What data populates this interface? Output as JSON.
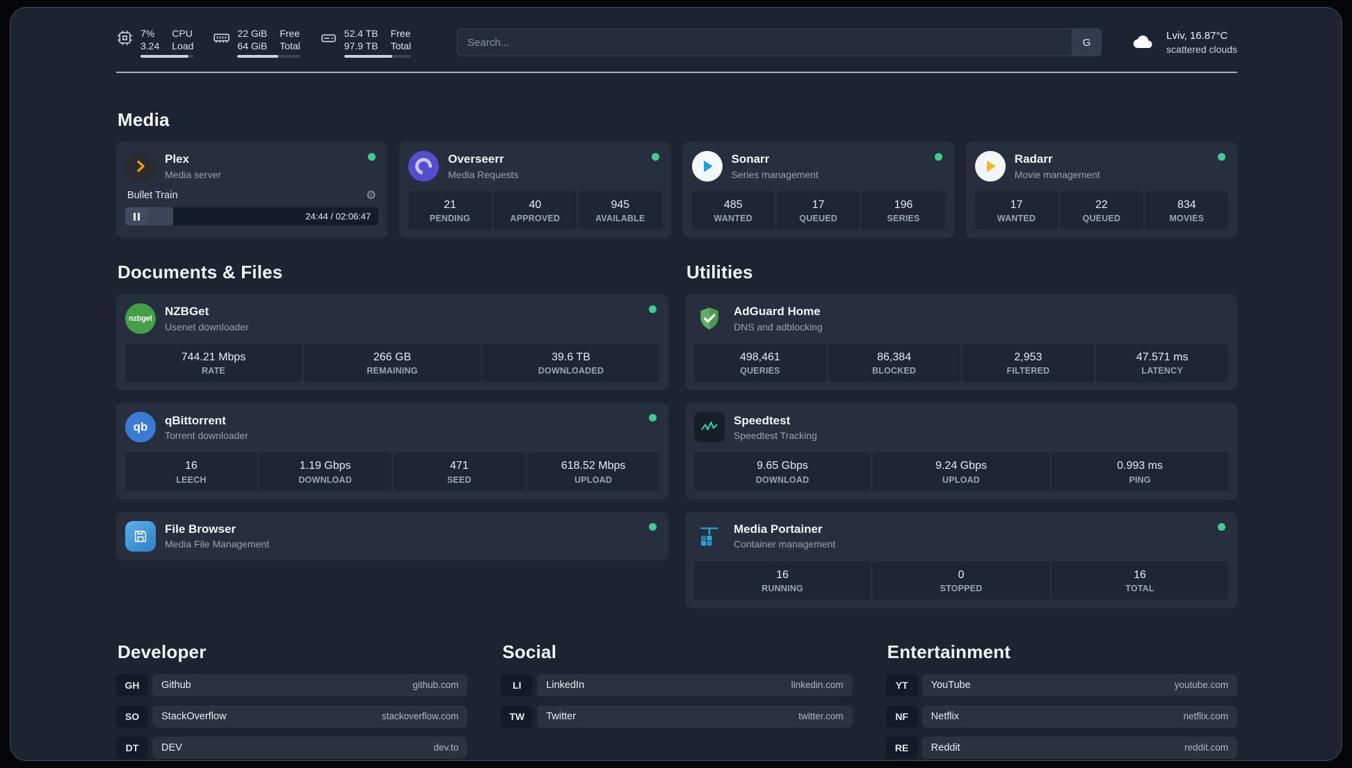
{
  "colors": {
    "background": "#1c2432",
    "card": "#272f3e",
    "stat_tile": "#1e2634",
    "status_green": "#3ecf8e",
    "plex_amber": "#e5a00d"
  },
  "topbar": {
    "cpu": {
      "value_top": "7%",
      "value_bottom": "3.24",
      "label_top": "CPU",
      "label_bottom": "Load",
      "bar_percent": 90
    },
    "ram": {
      "value_top": "22 GiB",
      "value_bottom": "64 GiB",
      "label_top": "Free",
      "label_bottom": "Total",
      "bar_percent": 65
    },
    "disk": {
      "value_top": "52.4 TB",
      "value_bottom": "97.9 TB",
      "label_top": "Free",
      "label_bottom": "Total",
      "bar_percent": 72
    },
    "search": {
      "placeholder": "Search...",
      "button_label": "G"
    },
    "weather": {
      "location": "Lviv, 16.87°C",
      "condition": "scattered clouds"
    }
  },
  "sections": {
    "media": "Media",
    "documents": "Documents & Files",
    "utilities": "Utilities"
  },
  "services": {
    "plex": {
      "name": "Plex",
      "subtitle": "Media server",
      "now_playing": "Bullet Train",
      "time": "24:44 / 02:06:47",
      "progress_percent": 19
    },
    "overseerr": {
      "name": "Overseerr",
      "subtitle": "Media Requests",
      "stats": [
        {
          "value": "21",
          "label": "PENDING"
        },
        {
          "value": "40",
          "label": "APPROVED"
        },
        {
          "value": "945",
          "label": "AVAILABLE"
        }
      ]
    },
    "sonarr": {
      "name": "Sonarr",
      "subtitle": "Series management",
      "stats": [
        {
          "value": "485",
          "label": "WANTED"
        },
        {
          "value": "17",
          "label": "QUEUED"
        },
        {
          "value": "196",
          "label": "SERIES"
        }
      ]
    },
    "radarr": {
      "name": "Radarr",
      "subtitle": "Movie management",
      "stats": [
        {
          "value": "17",
          "label": "WANTED"
        },
        {
          "value": "22",
          "label": "QUEUED"
        },
        {
          "value": "834",
          "label": "MOVIES"
        }
      ]
    },
    "nzbget": {
      "name": "NZBGet",
      "subtitle": "Usenet downloader",
      "icon_text": "nzbget",
      "stats": [
        {
          "value": "744.21 Mbps",
          "label": "RATE"
        },
        {
          "value": "266 GB",
          "label": "REMAINING"
        },
        {
          "value": "39.6 TB",
          "label": "DOWNLOADED"
        }
      ]
    },
    "qbittorrent": {
      "name": "qBittorrent",
      "subtitle": "Torrent downloader",
      "icon_text": "qb",
      "stats": [
        {
          "value": "16",
          "label": "LEECH"
        },
        {
          "value": "1.19 Gbps",
          "label": "DOWNLOAD"
        },
        {
          "value": "471",
          "label": "SEED"
        },
        {
          "value": "618.52 Mbps",
          "label": "UPLOAD"
        }
      ]
    },
    "filebrowser": {
      "name": "File Browser",
      "subtitle": "Media File Management"
    },
    "adguard": {
      "name": "AdGuard Home",
      "subtitle": "DNS and adblocking",
      "stats": [
        {
          "value": "498,461",
          "label": "QUERIES"
        },
        {
          "value": "86,384",
          "label": "BLOCKED"
        },
        {
          "value": "2,953",
          "label": "FILTERED"
        },
        {
          "value": "47.571 ms",
          "label": "LATENCY"
        }
      ]
    },
    "speedtest": {
      "name": "Speedtest",
      "subtitle": "Speedtest Tracking",
      "stats": [
        {
          "value": "9.65 Gbps",
          "label": "DOWNLOAD"
        },
        {
          "value": "9.24 Gbps",
          "label": "UPLOAD"
        },
        {
          "value": "0.993 ms",
          "label": "PING"
        }
      ]
    },
    "portainer": {
      "name": "Media Portainer",
      "subtitle": "Container management",
      "stats": [
        {
          "value": "16",
          "label": "RUNNING"
        },
        {
          "value": "0",
          "label": "STOPPED"
        },
        {
          "value": "16",
          "label": "TOTAL"
        }
      ]
    }
  },
  "bookmarks": [
    {
      "title": "Developer",
      "items": [
        {
          "abbr": "GH",
          "name": "Github",
          "url": "github.com"
        },
        {
          "abbr": "SO",
          "name": "StackOverflow",
          "url": "stackoverflow.com"
        },
        {
          "abbr": "DT",
          "name": "DEV",
          "url": "dev.to"
        }
      ]
    },
    {
      "title": "Social",
      "items": [
        {
          "abbr": "LI",
          "name": "LinkedIn",
          "url": "linkedin.com"
        },
        {
          "abbr": "TW",
          "name": "Twitter",
          "url": "twitter.com"
        }
      ]
    },
    {
      "title": "Entertainment",
      "items": [
        {
          "abbr": "YT",
          "name": "YouTube",
          "url": "youtube.com"
        },
        {
          "abbr": "NF",
          "name": "Netflix",
          "url": "netflix.com"
        },
        {
          "abbr": "RE",
          "name": "Reddit",
          "url": "reddit.com"
        }
      ]
    }
  ]
}
